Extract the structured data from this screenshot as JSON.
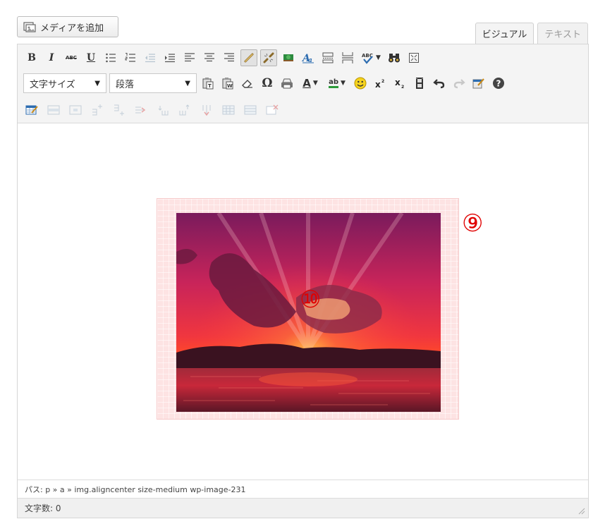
{
  "media_button": {
    "label": "メディアを追加",
    "icon": "media-icon"
  },
  "tabs": [
    {
      "label": "ビジュアル",
      "active": true
    },
    {
      "label": "テキスト",
      "active": false
    }
  ],
  "toolbar": {
    "row1": {
      "bold": "B",
      "italic": "I",
      "strikethrough": "ABC",
      "underline": "U"
    },
    "row2": {
      "font_size_select": "文字サイズ",
      "format_select": "段落",
      "omega": "Ω",
      "text_color": "A",
      "highlight": "ab"
    },
    "row1_spellcheck": "ABC"
  },
  "content": {
    "image_alt_colors": {
      "sky_top": "#7a1a5a",
      "sky_mid": "#e8305a",
      "horizon": "#ff4a2a",
      "water": "#7a1e2e"
    },
    "callout_9": "⑨",
    "callout_10": "⑩"
  },
  "status": {
    "path": "パス: p » a » img.aligncenter size-medium wp-image-231",
    "word_count": "文字数: 0"
  },
  "colors": {
    "accent_red": "#e00000",
    "selection_pink": "#fde3e3"
  }
}
